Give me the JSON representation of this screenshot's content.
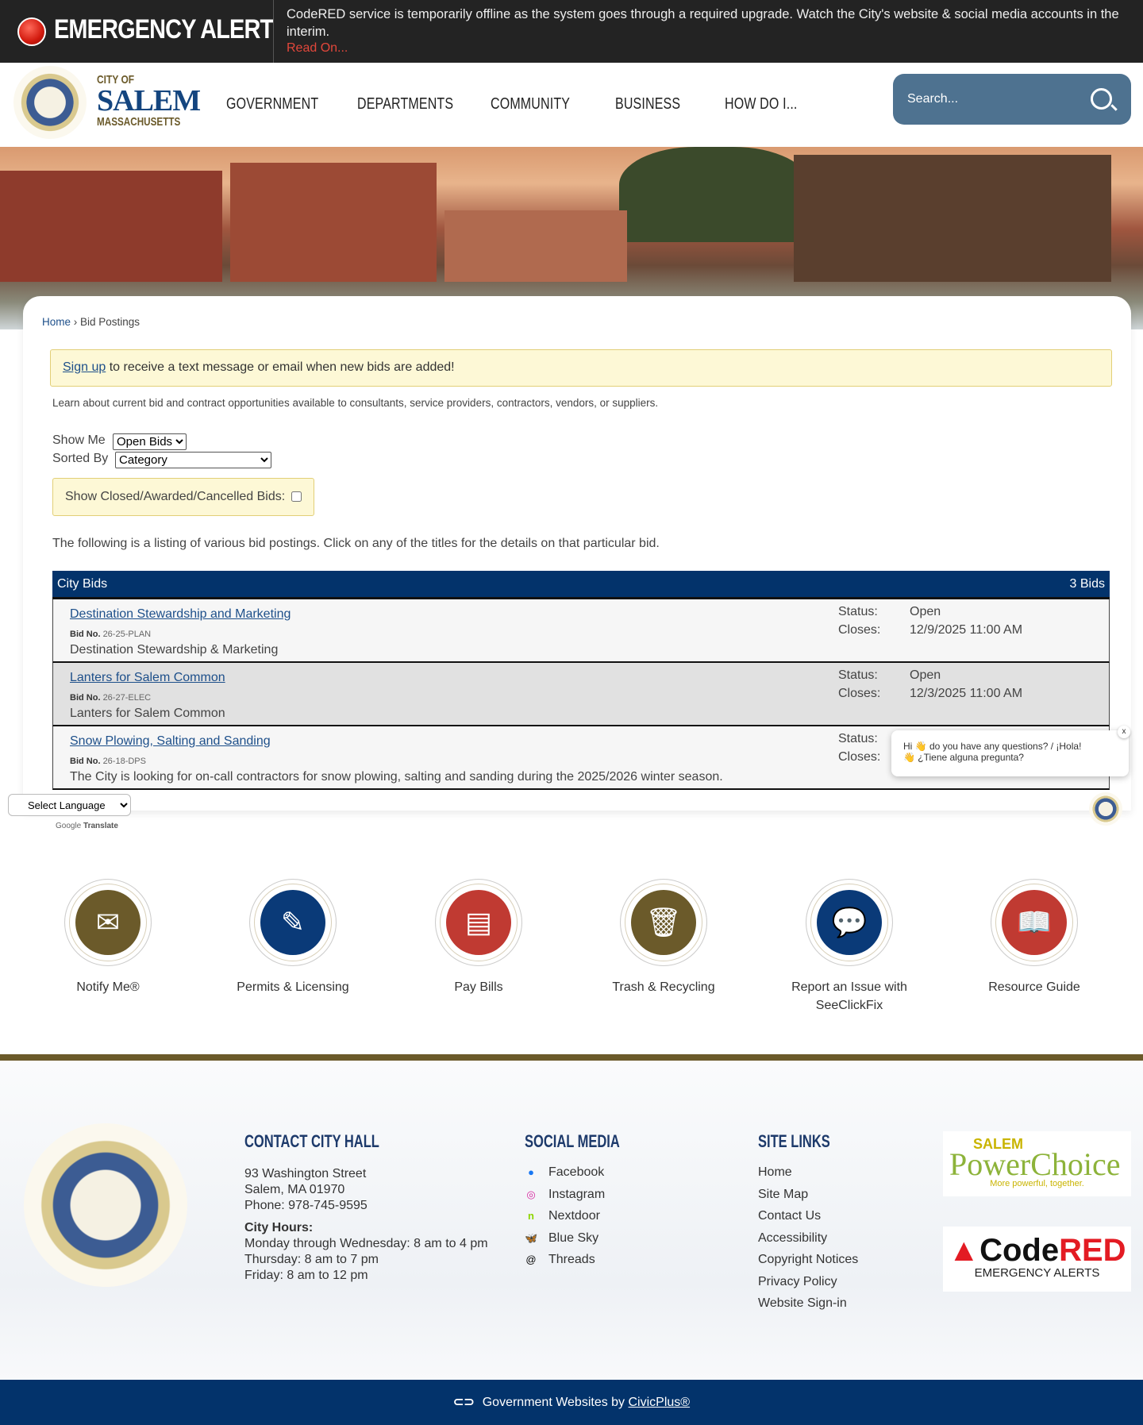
{
  "alert": {
    "title": "EMERGENCY ALERT",
    "message": "CodeRED service is temporarily offline as the system goes through a required upgrade. Watch the City's website & social media accounts in the interim.",
    "link": "Read On..."
  },
  "header": {
    "logo": {
      "city_of": "CITY OF",
      "salem": "SALEM",
      "state": "MASSACHUSETTS"
    },
    "nav": [
      "GOVERNMENT",
      "DEPARTMENTS",
      "COMMUNITY",
      "BUSINESS",
      "HOW DO I..."
    ],
    "search_placeholder": "Search..."
  },
  "breadcrumb": {
    "home": "Home",
    "sep": " › ",
    "current": "Bid Postings"
  },
  "notice": {
    "link": "Sign up",
    "text": " to receive a text message or email when new bids are added!"
  },
  "intro": "Learn about current bid and contract opportunities available to consultants, service providers, contractors, vendors, or suppliers.",
  "filters": {
    "show_me_label": "Show Me",
    "show_me_value": "Open Bids",
    "sorted_by_label": "Sorted By",
    "sorted_by_value": "Category",
    "closed_label": "Show Closed/Awarded/Cancelled Bids:"
  },
  "listing_text": "The following is a listing of various bid postings. Click on any of the titles for the details on that particular bid.",
  "table": {
    "title": "City Bids",
    "count": "3 Bids",
    "bid_no_label": "Bid No.",
    "status_label": "Status:",
    "closes_label": "Closes:",
    "rows": [
      {
        "title": "Destination Stewardship and Marketing",
        "bid_no": "26-25-PLAN",
        "desc": "Destination Stewardship & Marketing",
        "status": "Open",
        "closes": "12/9/2025 11:00 AM"
      },
      {
        "title": "Lanters for Salem Common",
        "bid_no": "26-27-ELEC",
        "desc": "Lanters for Salem Common",
        "status": "Open",
        "closes": "12/3/2025 11:00 AM"
      },
      {
        "title": "Snow Plowing, Salting and Sanding",
        "bid_no": "26-18-DPS",
        "desc": "The City is looking for on-call contractors for snow plowing, salting and sanding during the 2025/2026 winter season."
      }
    ]
  },
  "chat": {
    "line1": "Hi 👋 do you have any questions? / ¡Hola!",
    "line2": "👋 ¿Tiene alguna pregunta?",
    "close": "x"
  },
  "translate": {
    "select": "Select Language",
    "google": "Google",
    "translate": "Translate"
  },
  "quick_links": [
    {
      "label": "Notify Me®",
      "icon": "phone-chat-icon",
      "color": "#6b5a2a",
      "glyph": "✉"
    },
    {
      "label": "Permits & Licensing",
      "icon": "scroll-icon",
      "color": "#0a3a78",
      "glyph": "📜"
    },
    {
      "label": "Pay Bills",
      "icon": "credit-card-icon",
      "color": "#c03a32",
      "glyph": "💳"
    },
    {
      "label": "Trash & Recycling",
      "icon": "trash-icon",
      "color": "#6b5a2a",
      "glyph": "🗑"
    },
    {
      "label": "Report an Issue with SeeClickFix",
      "icon": "chat-bubbles-icon",
      "color": "#0a3a78",
      "glyph": "💬"
    },
    {
      "label": "Resource Guide",
      "icon": "book-icon",
      "color": "#c03a32",
      "glyph": "📖"
    }
  ],
  "footer": {
    "contact": {
      "heading": "CONTACT CITY HALL",
      "address1": "93 Washington Street",
      "address2": "Salem, MA 01970",
      "phone": "Phone: 978-745-9595",
      "hours_label": "City Hours:",
      "hours": [
        "Monday through Wednesday: 8 am to 4 pm",
        "Thursday: 8 am to 7 pm",
        "Friday: 8 am to 12 pm"
      ]
    },
    "social": {
      "heading": "SOCIAL MEDIA",
      "items": [
        "Facebook",
        "Instagram",
        "Nextdoor",
        "Blue Sky",
        "Threads"
      ]
    },
    "site_links": {
      "heading": "SITE LINKS",
      "items": [
        "Home",
        "Site Map",
        "Contact Us",
        "Accessibility",
        "Copyright Notices",
        "Privacy Policy",
        "Website Sign-in"
      ]
    },
    "powerchoice": {
      "salem": "SALEM",
      "name": "PowerChoice",
      "tagline": "More powerful, together."
    },
    "codered": {
      "code": "Code",
      "red": "RED",
      "sub": "EMERGENCY ALERTS"
    },
    "bottom": {
      "text": "Government Websites by ",
      "link": "CivicPlus®"
    }
  }
}
